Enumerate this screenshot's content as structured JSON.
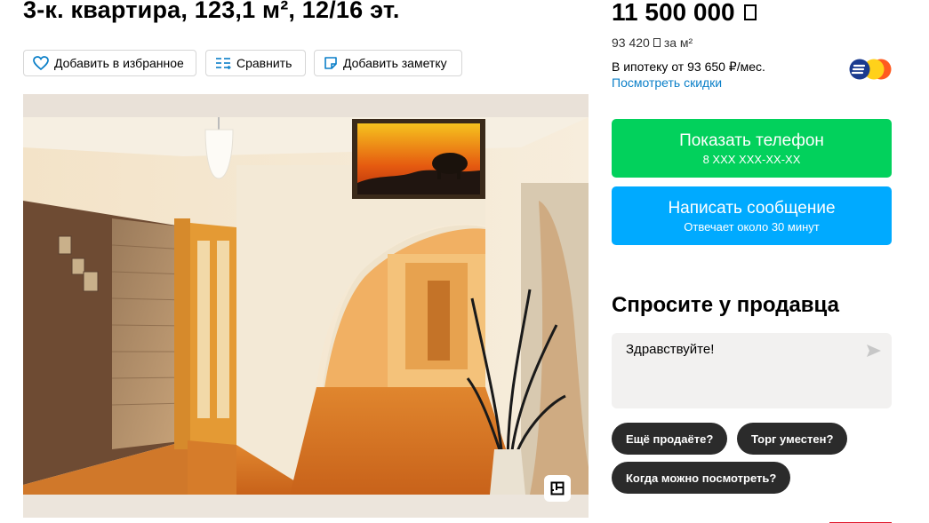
{
  "listing": {
    "title": "3-к. квартира, 123,1 м², 12/16 эт."
  },
  "actions": {
    "favorite_label": "Добавить в избранное",
    "compare_label": "Сравнить",
    "note_label": "Добавить заметку"
  },
  "price": {
    "value": "11 500 000",
    "per_m2": "93 420",
    "per_m2_suffix": "за м²",
    "mortgage": "В ипотеку от 93 650 ₽/мес.",
    "discounts_link": "Посмотреть скидки"
  },
  "contact": {
    "phone_label": "Показать телефон",
    "phone_masked": "8 XXX XXX-XX-XX",
    "message_label": "Написать сообщение",
    "message_sub": "Отвечает около 30 минут"
  },
  "ask": {
    "title": "Спросите у продавца",
    "message_value": "Здравствуйте!",
    "quick_replies": [
      "Ещё продаёте?",
      "Торг уместен?",
      "Когда можно посмотреть?"
    ]
  },
  "colors": {
    "phone_button": "#02d15c",
    "message_button": "#00aaff",
    "link": "#0a7fc8",
    "chip": "#2b2b2b"
  },
  "icons": {
    "favorite": "heart-icon",
    "compare": "compare-icon",
    "note": "note-icon",
    "send": "send-icon",
    "floorplan": "floorplan-icon",
    "bank": "bank-logo"
  }
}
